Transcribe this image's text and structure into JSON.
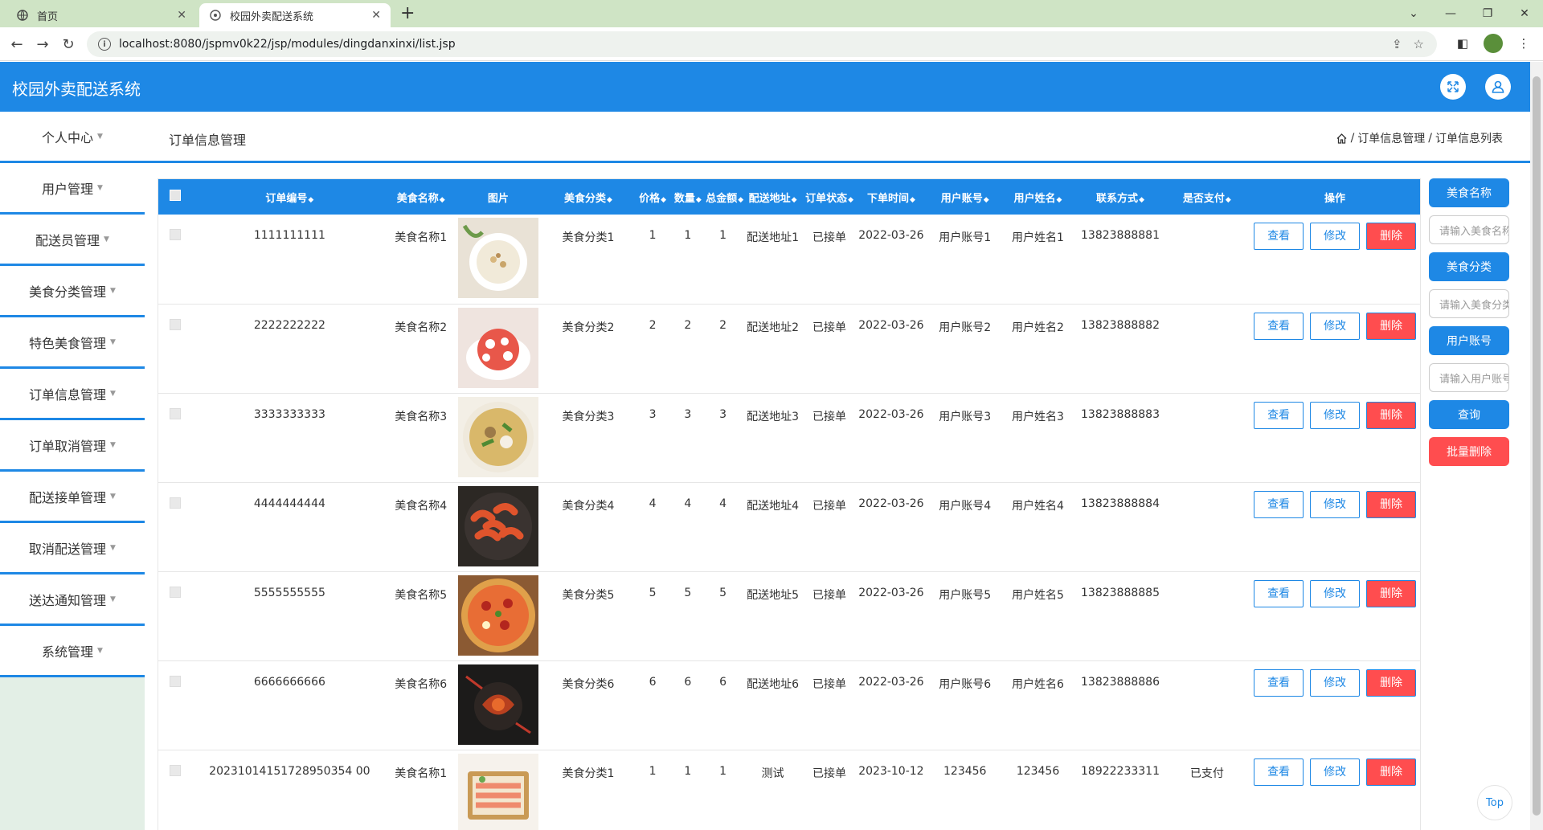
{
  "browser": {
    "tabs": [
      {
        "title": "首页",
        "active": false
      },
      {
        "title": "校园外卖配送系统",
        "active": true
      }
    ],
    "url": "localhost:8080/jspmv0k22/jsp/modules/dingdanxinxi/list.jsp"
  },
  "app": {
    "title": "校园外卖配送系统"
  },
  "sidebar": {
    "items": [
      {
        "label": "个人中心"
      },
      {
        "label": "用户管理"
      },
      {
        "label": "配送员管理"
      },
      {
        "label": "美食分类管理"
      },
      {
        "label": "特色美食管理"
      },
      {
        "label": "订单信息管理"
      },
      {
        "label": "订单取消管理"
      },
      {
        "label": "配送接单管理"
      },
      {
        "label": "取消配送管理"
      },
      {
        "label": "送达通知管理"
      },
      {
        "label": "系统管理"
      }
    ]
  },
  "page": {
    "title": "订单信息管理",
    "breadcrumb": [
      "订单信息管理",
      "订单信息列表"
    ],
    "separator": "/"
  },
  "table": {
    "headers": [
      "订单编号",
      "美食名称",
      "图片",
      "美食分类",
      "价格",
      "数量",
      "总金额",
      "配送地址",
      "订单状态",
      "下单时间",
      "用户账号",
      "用户姓名",
      "联系方式",
      "是否支付",
      "操作"
    ],
    "rows": [
      {
        "order_no": "1111111111",
        "food": "美食名称1",
        "category": "美食分类1",
        "price": "1",
        "qty": "1",
        "total": "1",
        "address": "配送地址1",
        "status": "已接单",
        "time": "2022-03-26",
        "account": "用户账号1",
        "name": "用户姓名1",
        "phone": "13823888881",
        "paid": "",
        "image": "soup"
      },
      {
        "order_no": "2222222222",
        "food": "美食名称2",
        "category": "美食分类2",
        "price": "2",
        "qty": "2",
        "total": "2",
        "address": "配送地址2",
        "status": "已接单",
        "time": "2022-03-26",
        "account": "用户账号2",
        "name": "用户姓名2",
        "phone": "13823888882",
        "paid": "",
        "image": "dessert"
      },
      {
        "order_no": "3333333333",
        "food": "美食名称3",
        "category": "美食分类3",
        "price": "3",
        "qty": "3",
        "total": "3",
        "address": "配送地址3",
        "status": "已接单",
        "time": "2022-03-26",
        "account": "用户账号3",
        "name": "用户姓名3",
        "phone": "13823888883",
        "paid": "",
        "image": "broth"
      },
      {
        "order_no": "4444444444",
        "food": "美食名称4",
        "category": "美食分类4",
        "price": "4",
        "qty": "4",
        "total": "4",
        "address": "配送地址4",
        "status": "已接单",
        "time": "2022-03-26",
        "account": "用户账号4",
        "name": "用户姓名4",
        "phone": "13823888884",
        "paid": "",
        "image": "shrimp"
      },
      {
        "order_no": "5555555555",
        "food": "美食名称5",
        "category": "美食分类5",
        "price": "5",
        "qty": "5",
        "total": "5",
        "address": "配送地址5",
        "status": "已接单",
        "time": "2022-03-26",
        "account": "用户账号5",
        "name": "用户姓名5",
        "phone": "13823888885",
        "paid": "",
        "image": "pizza"
      },
      {
        "order_no": "6666666666",
        "food": "美食名称6",
        "category": "美食分类6",
        "price": "6",
        "qty": "6",
        "total": "6",
        "address": "配送地址6",
        "status": "已接单",
        "time": "2022-03-26",
        "account": "用户账号6",
        "name": "用户姓名6",
        "phone": "13823888886",
        "paid": "",
        "image": "crayfish"
      },
      {
        "order_no": "20231014151728950354 00",
        "food": "美食名称1",
        "category": "美食分类1",
        "price": "1",
        "qty": "1",
        "total": "1",
        "address": "测试",
        "status": "已接单",
        "time": "2023-10-12",
        "account": "123456",
        "name": "123456",
        "phone": "18922233311",
        "paid": "已支付",
        "image": "platter"
      }
    ],
    "actions": {
      "view": "查看",
      "edit": "修改",
      "delete": "删除"
    }
  },
  "search": {
    "food_name_label": "美食名称",
    "food_name_placeholder": "请输入美食名称",
    "category_label": "美食分类",
    "category_placeholder": "请输入美食分类",
    "account_label": "用户账号",
    "account_placeholder": "请输入用户账号",
    "query_label": "查询",
    "batch_delete_label": "批量删除"
  },
  "back_to_top": "Top",
  "colors": {
    "primary": "#1e88e5",
    "danger": "#ff4d4f",
    "tabbar": "#cfe4c5",
    "sidebar_bg": "#e3efe6"
  }
}
